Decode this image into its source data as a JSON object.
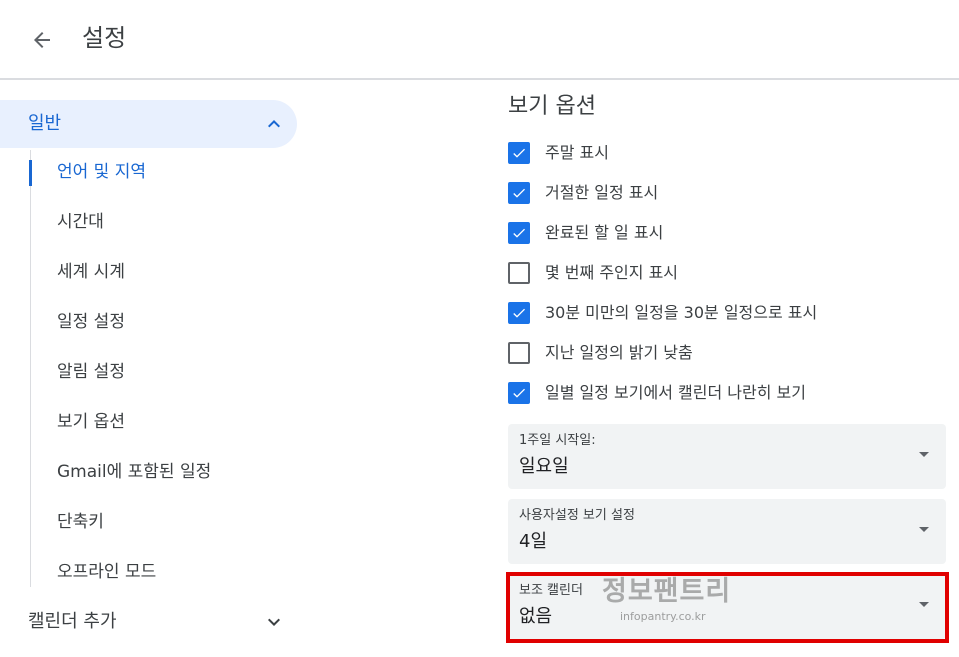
{
  "header": {
    "title": "설정",
    "back_icon": "arrow-left-icon"
  },
  "sidebar": {
    "general": {
      "label": "일반",
      "icon": "chevron-up-icon"
    },
    "sub_items": [
      {
        "label": "언어 및 지역",
        "active": true
      },
      {
        "label": "시간대",
        "active": false
      },
      {
        "label": "세계 시계",
        "active": false
      },
      {
        "label": "일정 설정",
        "active": false
      },
      {
        "label": "알림 설정",
        "active": false
      },
      {
        "label": "보기 옵션",
        "active": false
      },
      {
        "label": "Gmail에 포함된 일정",
        "active": false
      },
      {
        "label": "단축키",
        "active": false
      },
      {
        "label": "오프라인 모드",
        "active": false
      }
    ],
    "add_calendar": {
      "label": "캘린더 추가",
      "icon": "chevron-down-icon"
    }
  },
  "view_options": {
    "title": "보기 옵션",
    "checkboxes": [
      {
        "label": "주말 표시",
        "checked": true
      },
      {
        "label": "거절한 일정 표시",
        "checked": true
      },
      {
        "label": "완료된 할 일 표시",
        "checked": true
      },
      {
        "label": "몇 번째 주인지 표시",
        "checked": false
      },
      {
        "label": "30분 미만의 일정을 30분 일정으로 표시",
        "checked": true
      },
      {
        "label": "지난 일정의 밝기 낮춤",
        "checked": false
      },
      {
        "label": "일별 일정 보기에서 캘린더 나란히 보기",
        "checked": true
      }
    ],
    "selects": [
      {
        "label": "1주일 시작일:",
        "value": "일요일"
      },
      {
        "label": "사용자설정 보기 설정",
        "value": "4일"
      },
      {
        "label": "보조 캘린더",
        "value": "없음"
      }
    ]
  },
  "watermark": {
    "title": "정보팬트리",
    "url": "infopantry.co.kr"
  },
  "colors": {
    "accent": "#1a73e8",
    "active_text": "#1967d2",
    "active_bg": "#e8f0fe",
    "highlight": "#e00000"
  }
}
